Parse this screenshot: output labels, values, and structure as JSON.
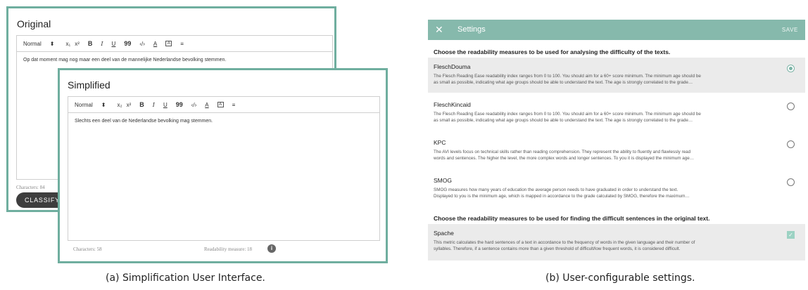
{
  "original_panel": {
    "title": "Original",
    "toolbar": {
      "style_select": "Normal",
      "select_arrow": "⬍",
      "subscript": "x₁",
      "superscript": "x²",
      "bold": "B",
      "italic": "I",
      "underline": "U",
      "quote": "99",
      "code": "‹/›",
      "font_color": "A",
      "highlight": "A",
      "align": "≡"
    },
    "text": "Op dat moment mag nog maar een deel van de mannelijke Nederlandse bevolking stemmen.",
    "char_count": "Characters: 84",
    "classify_button": "CLASSIFY SE"
  },
  "simplified_panel": {
    "title": "Simplified",
    "toolbar": {
      "style_select": "Normal",
      "select_arrow": "⬍",
      "subscript": "x₂",
      "superscript": "x²",
      "bold": "B",
      "italic": "I",
      "underline": "U",
      "quote": "99",
      "code": "‹/›",
      "font_color": "A",
      "highlight": "A",
      "align": "≡"
    },
    "text": "Slechts een deel van de Nederlandse bevolking mag stemmen.",
    "char_count": "Characters: 58",
    "readability": "Readability measure: 18",
    "info_glyph": "i"
  },
  "captions": {
    "a": "(a) Simplification User Interface.",
    "b": "(b) User-configurable settings."
  },
  "settings": {
    "close_glyph": "✕",
    "title": "Settings",
    "save_label": "SAVE",
    "section1_heading": "Choose the readability measures to be used for analysing the difficulty of the texts.",
    "measures": [
      {
        "name": "FleschDouma",
        "desc1": "The Flesch Reading Ease readability index ranges from 0 to 100. You should aim for a 60+ score minimum. The minimum age should be",
        "desc2": "as small as possible, indicating what age groups should be able to understand the text. The age is strongly correlated to the grade…",
        "selected": true
      },
      {
        "name": "FleschKincaid",
        "desc1": "The Flesch Reading Ease readability index ranges from 0 to 100. You should aim for a 60+ score minimum. The minimum age should be",
        "desc2": "as small as possible, indicating what age groups should be able to understand the text. The age is strongly correlated to the grade…",
        "selected": false
      },
      {
        "name": "KPC",
        "desc1": "The AVI levels focus on technical skills rather than reading comprehension. They represent the ability to fluently and flawlessly read",
        "desc2": "words and sentences. The higher the level, the more complex words and longer sentences. To you it is displayed the minimum age…",
        "selected": false
      },
      {
        "name": "SMOG",
        "desc1": "SMOG measures how many years of education the average person needs to have graduated in order to understand the text.",
        "desc2": "Displayed to you is the minimum age, which is mapped in accordance to the grade calculated by SMOG, therefore the maximum…",
        "selected": false
      }
    ],
    "section2_heading": "Choose the readability measures to be used for finding the difficult sentences in the original text.",
    "spache": {
      "name": "Spache",
      "desc1": "This metric calculates the hard sentences of a text in accordance to the frequency of words in the given language and their number of",
      "desc2": "syllables. Therefore, if a sentence contains more than a given threshold of difficult/low frequent words, it is considered difficult.",
      "checked": true,
      "check_glyph": "✓"
    },
    "accent_color": "#86b9ac"
  }
}
